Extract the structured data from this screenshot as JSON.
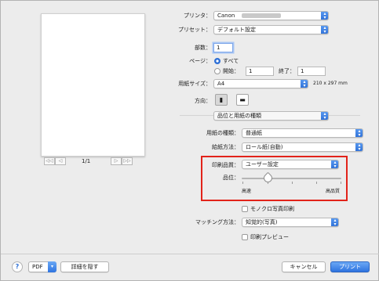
{
  "printer": {
    "label": "プリンタ：",
    "value": "Canon"
  },
  "presets": {
    "label": "プリセット：",
    "value": "デフォルト設定"
  },
  "copies": {
    "label": "部数：",
    "value": "1"
  },
  "pages": {
    "label": "ページ：",
    "all_label": "すべて",
    "from_label": "開始：",
    "from_value": "1",
    "to_label": "終了：",
    "to_value": "1"
  },
  "paper_size": {
    "label": "用紙サイズ：",
    "value": "A4",
    "dims": "210 x 297 mm"
  },
  "orientation": {
    "label": "方向：",
    "portrait_icon": "portrait-icon",
    "landscape_icon": "landscape-icon"
  },
  "section_popup": {
    "value": "品位と用紙の種類"
  },
  "media_type": {
    "label": "用紙の種類：",
    "value": "普通紙"
  },
  "paper_source": {
    "label": "給紙方法：",
    "value": "ロール紙(自動)"
  },
  "print_quality": {
    "label": "印刷品質：",
    "value": "ユーザー設定"
  },
  "quality_slider": {
    "label": "品位：",
    "min_label": "高速",
    "max_label": "高品質",
    "level": 0.25
  },
  "grayscale": {
    "label": "モノクロ写真印刷",
    "checked": false
  },
  "matching": {
    "label": "マッチング方法：",
    "value": "知覚的(写真)"
  },
  "print_preview": {
    "label": "印刷プレビュー",
    "checked": false
  },
  "pager": {
    "page_text": "1/1",
    "first": "◁◁",
    "prev": "◁",
    "next": "▷",
    "last": "▷▷"
  },
  "footer": {
    "help": "?",
    "pdf": "PDF",
    "hide_details": "詳細を隠す",
    "cancel": "キャンセル",
    "print": "プリント"
  },
  "colors": {
    "accent": "#2d6fd6",
    "highlight": "#e2231a"
  }
}
